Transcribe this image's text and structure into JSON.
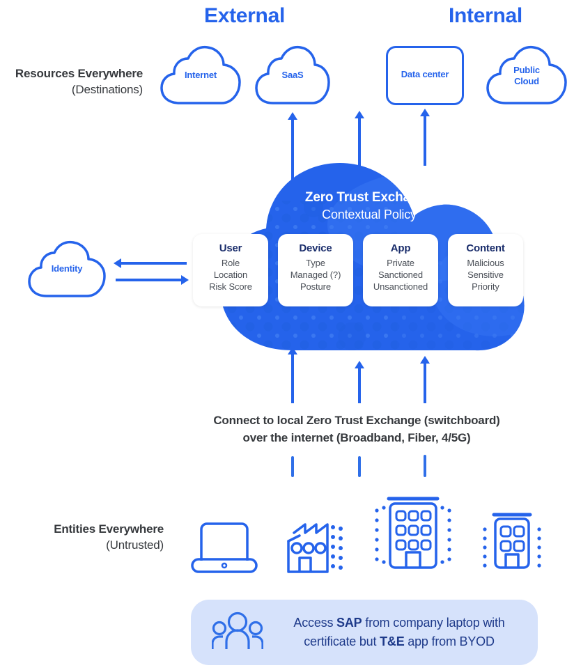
{
  "headers": {
    "external": "External",
    "internal": "Internal"
  },
  "row_labels": {
    "resources": {
      "main": "Resources Everywhere",
      "sub": "(Destinations)"
    },
    "entities": {
      "main": "Entities Everywhere",
      "sub": "(Untrusted)"
    }
  },
  "resources": [
    {
      "id": "internet",
      "label": "Internet",
      "shape": "cloud"
    },
    {
      "id": "saas",
      "label": "SaaS",
      "shape": "cloud"
    },
    {
      "id": "datacenter",
      "label": "Data center",
      "shape": "rounded-box"
    },
    {
      "id": "publiccloud",
      "label": "Public\nCloud",
      "shape": "cloud",
      "line1": "Public",
      "line2": "Cloud"
    }
  ],
  "identity": {
    "label": "Identity",
    "shape": "cloud"
  },
  "exchange": {
    "title": "Zero Trust Exchange",
    "subtitle": "Contextual Policy",
    "cloud_color": "#2563eb",
    "cloud_color_light": "#3b7bf5"
  },
  "pillars": [
    {
      "title": "User",
      "items": [
        "Role",
        "Location",
        "Risk Score"
      ]
    },
    {
      "title": "Device",
      "items": [
        "Type",
        "Managed (?)",
        "Posture"
      ]
    },
    {
      "title": "App",
      "items": [
        "Private",
        "Sanctioned",
        "Unsanctioned"
      ]
    },
    {
      "title": "Content",
      "items": [
        "Malicious",
        "Sensitive",
        "Priority"
      ]
    }
  ],
  "connect": {
    "line1": "Connect to local Zero Trust Exchange (switchboard)",
    "line2": "over the internet (Broadband, Fiber, 4/5G)"
  },
  "entities": [
    {
      "id": "laptop",
      "icon": "laptop-icon"
    },
    {
      "id": "factory",
      "icon": "factory-icon"
    },
    {
      "id": "office-large",
      "icon": "office-building-icon"
    },
    {
      "id": "office-small",
      "icon": "branch-building-icon"
    }
  ],
  "callout": {
    "icon": "people-group-icon",
    "segments": [
      {
        "text": "Access ",
        "bold": false
      },
      {
        "text": "SAP",
        "bold": true
      },
      {
        "text": " from company laptop with certificate but ",
        "bold": false
      },
      {
        "text": "T&E",
        "bold": true
      },
      {
        "text": " app from BYOD",
        "bold": false
      }
    ],
    "full_text": "Access SAP from company laptop with certificate but T&E app from BYOD",
    "background": "#d6e2fb",
    "text_color": "#1e3a8a"
  },
  "colors": {
    "accent_blue": "#2563eb",
    "dark_text": "#36393d",
    "navy": "#1a2d6b",
    "body_gray": "#4a4f57"
  }
}
